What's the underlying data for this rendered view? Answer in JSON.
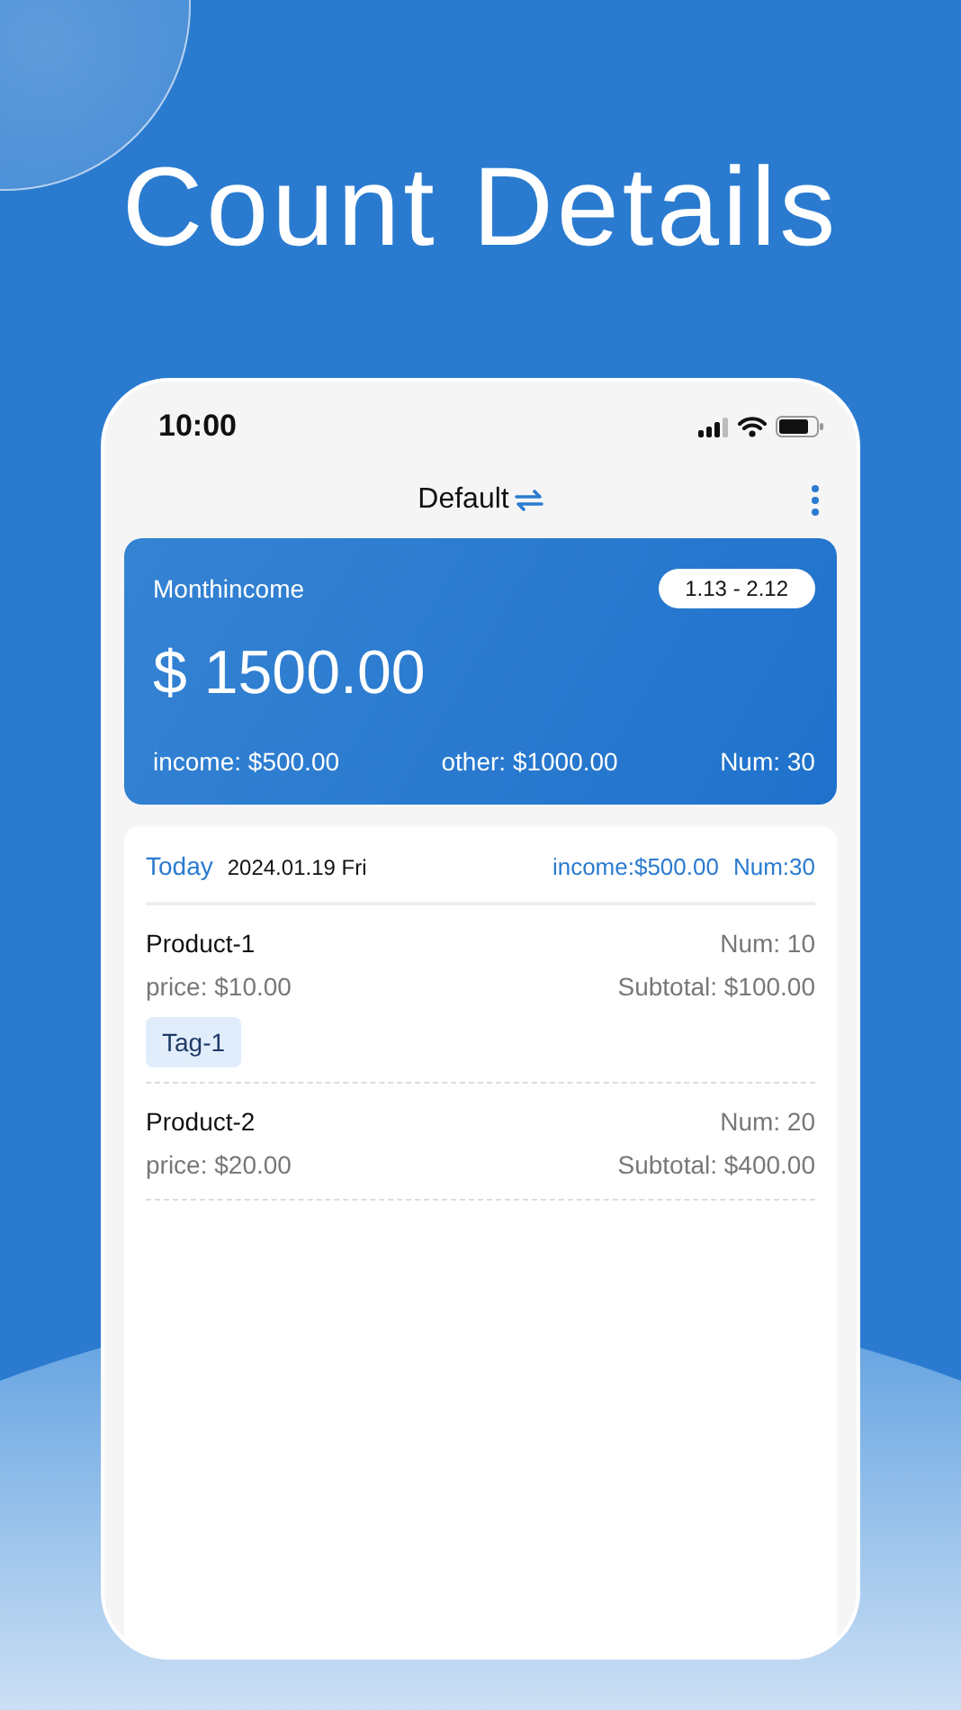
{
  "headline": "Count Details",
  "status_bar": {
    "time": "10:00"
  },
  "nav": {
    "title": "Default"
  },
  "summary": {
    "label": "Monthincome",
    "range": "1.13 - 2.12",
    "amount": "$ 1500.00",
    "income": "income: $500.00",
    "other": "other: $1000.00",
    "num": "Num: 30"
  },
  "day": {
    "label": "Today",
    "date": "2024.01.19 Fri",
    "income": "income:$500.00",
    "num": "Num:30"
  },
  "items": [
    {
      "name": "Product-1",
      "num": "Num: 10",
      "price": "price: $10.00",
      "subtotal": "Subtotal: $100.00",
      "tags": [
        "Tag-1"
      ]
    },
    {
      "name": "Product-2",
      "num": "Num: 20",
      "price": "price: $20.00",
      "subtotal": "Subtotal: $400.00"
    }
  ]
}
